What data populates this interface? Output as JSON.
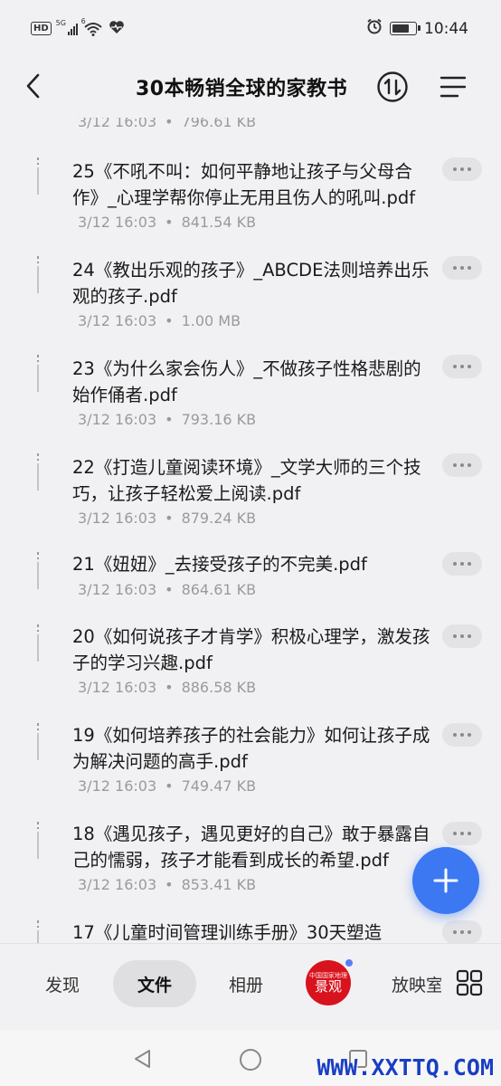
{
  "status_bar": {
    "hd": "HD",
    "network": "5G",
    "wifi_badge": "6",
    "time": "10:44",
    "battery_level": 0.8
  },
  "header": {
    "title": "30本畅销全球的家教书"
  },
  "partial_top_meta": {
    "date": "3/12 16:03",
    "size": "796.61 KB"
  },
  "files": [
    {
      "name": "25《不吼不叫：如何平静地让孩子与父母合作》_心理学帮你停止无用且伤人的吼叫.pdf",
      "date": "3/12 16:03",
      "size": "841.54 KB"
    },
    {
      "name": "24《教出乐观的孩子》_ABCDE法则培养出乐观的孩子.pdf",
      "date": "3/12 16:03",
      "size": "1.00 MB"
    },
    {
      "name": "23《为什么家会伤人》_不做孩子性格悲剧的始作俑者.pdf",
      "date": "3/12 16:03",
      "size": "793.16 KB"
    },
    {
      "name": "22《打造儿童阅读环境》_文学大师的三个技巧，让孩子轻松爱上阅读.pdf",
      "date": "3/12 16:03",
      "size": "879.24 KB"
    },
    {
      "name": "21《妞妞》_去接受孩子的不完美.pdf",
      "date": "3/12 16:03",
      "size": "864.61 KB"
    },
    {
      "name": "20《如何说孩子才肯学》积极心理学，激发孩子的学习兴趣.pdf",
      "date": "3/12 16:03",
      "size": "886.58 KB"
    },
    {
      "name": "19《如何培养孩子的社会能力》如何让孩子成为解决问题的高手.pdf",
      "date": "3/12 16:03",
      "size": "749.47 KB"
    },
    {
      "name": "18《遇见孩子，遇见更好的自己》敢于暴露自己的懦弱，孩子才能看到成长的希望.pdf",
      "date": "3/12 16:03",
      "size": "853.41 KB"
    },
    {
      "name": "17《儿童时间管理训练手册》30天塑造",
      "date": "",
      "size": ""
    }
  ],
  "meta_separator": "•",
  "bottom_tabs": {
    "discover": "发现",
    "files": "文件",
    "album": "相册",
    "brand_top": "中国国家地理",
    "brand_main": "景观",
    "cast": "放映室"
  },
  "watermark": "WWW.XXTTQ.COM",
  "colors": {
    "accent": "#3b78f2",
    "background": "#f1f1f3",
    "brand_red": "#d8131e",
    "meta_gray": "#9a9a9a"
  },
  "icons": {
    "back": "chevron-left-icon",
    "sort": "sort-icon",
    "menu": "menu-icon",
    "more": "more-horizontal-icon",
    "add": "plus-icon",
    "grid": "grid-icon",
    "nav_back": "triangle-back-icon",
    "nav_home": "circle-home-icon",
    "nav_recent": "square-recent-icon"
  }
}
